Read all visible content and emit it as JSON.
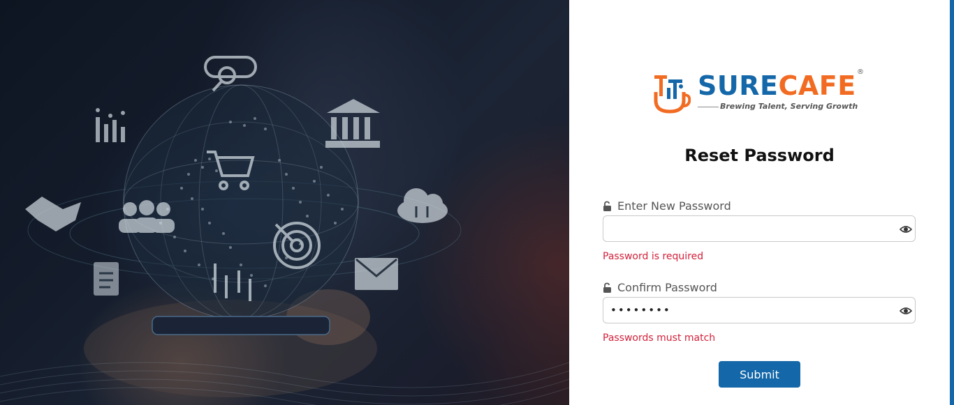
{
  "brand": {
    "name_part1": "SURE",
    "name_part2": "CAFE",
    "registered_mark": "®",
    "tagline": "Brewing Talent, Serving Growth"
  },
  "page_title": "Reset Password",
  "form": {
    "new_password": {
      "label": "Enter New Password",
      "value": "",
      "error": "Password is required"
    },
    "confirm_password": {
      "label": "Confirm Password",
      "value": "••••••••",
      "error": "Passwords must match"
    },
    "submit_label": "Submit"
  },
  "colors": {
    "brand_blue": "#1467a8",
    "brand_orange": "#f26b22",
    "error_red": "#d3203a"
  },
  "icons": {
    "hero": [
      "magnifier-icon",
      "bar-chart-icon",
      "bank-icon",
      "shopping-cart-icon",
      "handshake-icon",
      "team-icon",
      "cloud-transfer-icon",
      "target-icon",
      "document-icon",
      "candlestick-icon",
      "envelope-icon",
      "smartphone-icon",
      "globe-icon"
    ],
    "form": [
      "lock-icon",
      "eye-icon"
    ]
  }
}
